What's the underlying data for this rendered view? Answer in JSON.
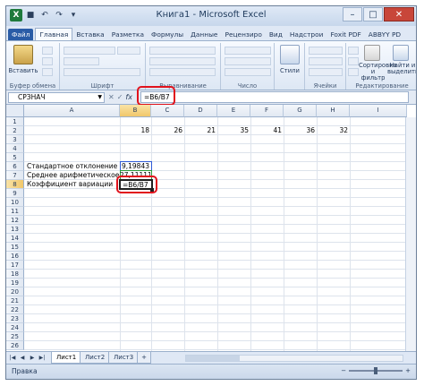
{
  "window": {
    "title": "Книга1 - Microsoft Excel",
    "controls": [
      "–",
      "□",
      "✕"
    ]
  },
  "ribbon_tabs": [
    "Файл",
    "Главная",
    "Вставка",
    "Разметка",
    "Формулы",
    "Данные",
    "Рецензиро",
    "Вид",
    "Надстрои",
    "Foxit PDF",
    "ABBYY PD"
  ],
  "ribbon_groups": {
    "clipboard": {
      "paste": "Вставить",
      "label": "Буфер обмена"
    },
    "font": {
      "label": "Шрифт"
    },
    "alignment": {
      "label": "Выравнивание"
    },
    "number": {
      "label": "Число"
    },
    "styles": {
      "styles": "Стили",
      "label": ""
    },
    "cells": {
      "label": "Ячейки"
    },
    "editing": {
      "sort": "Сортировка и фильтр",
      "find": "Найти и выделить",
      "label": "Редактирование"
    }
  },
  "formula_bar": {
    "name_box": "СРЗНАЧ",
    "cancel": "✕",
    "enter": "✓",
    "fx": "fx",
    "formula": "=B6/B7"
  },
  "columns": [
    "A",
    "B",
    "C",
    "D",
    "E",
    "F",
    "G",
    "H",
    "I"
  ],
  "rows": [
    "1",
    "2",
    "3",
    "4",
    "5",
    "6",
    "7",
    "8",
    "9",
    "10",
    "11",
    "12",
    "13",
    "14",
    "15",
    "16",
    "17",
    "18",
    "19",
    "20",
    "21",
    "22",
    "23",
    "24",
    "25",
    "26"
  ],
  "row2_values": [
    "18",
    "26",
    "21",
    "35",
    "41",
    "36",
    "32"
  ],
  "labels": {
    "std_dev": "Стандартное отклонение",
    "mean": "Среднее арифметическое",
    "cv": "Коэффициент вариации"
  },
  "values": {
    "std_dev": "9,19843",
    "mean": "27,11111",
    "cv_editing": "=B6/B7"
  },
  "sheets": [
    "Лист1",
    "Лист2",
    "Лист3"
  ],
  "status": "Правка",
  "colors": {
    "file_tab": "#2a5ca6",
    "highlight": "#e1131d",
    "ref_blue": "#2f5bd6",
    "ref_green": "#2a9a3a"
  }
}
